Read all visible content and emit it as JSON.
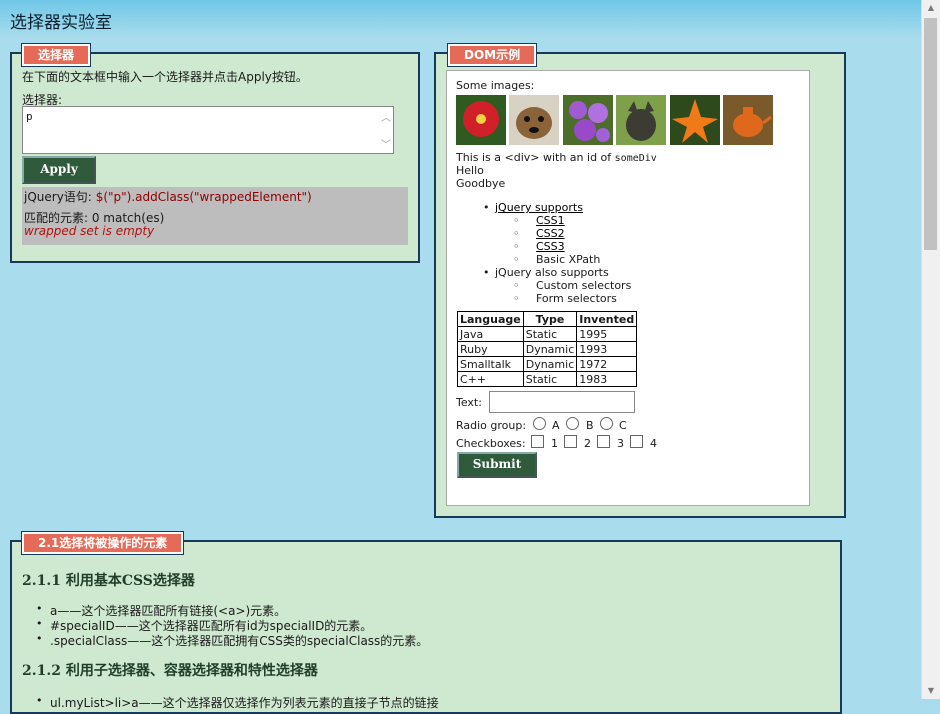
{
  "page": {
    "title": "选择器实验室"
  },
  "selector_panel": {
    "legend": "选择器",
    "instruction": "在下面的文本框中输入一个选择器并点击Apply按钮。",
    "selector_label": "选择器:",
    "selector_value": "p",
    "apply_label": "Apply",
    "statement_prefix": "jQuery语句:",
    "statement_code": "$(\"p\").addClass(\"wrappedElement\")",
    "match_text": "匹配的元素: 0 match(es)",
    "empty_text": "wrapped set is empty"
  },
  "dom_panel": {
    "legend": "DOM示例",
    "images_label": "Some images:",
    "images": [
      {
        "name": "flower-red",
        "color": "#c8232b"
      },
      {
        "name": "dog",
        "color": "#8a6a3a"
      },
      {
        "name": "flower-purple",
        "color": "#9b4fc0"
      },
      {
        "name": "cat",
        "color": "#5a5a4a"
      },
      {
        "name": "lily-orange",
        "color": "#e87a1a"
      },
      {
        "name": "teapot",
        "color": "#d2601a"
      }
    ],
    "div_text_prefix": "This is a <div> with an id of",
    "div_id": "someDiv",
    "hello": "Hello",
    "goodbye": "Goodbye",
    "list": {
      "item1": "jQuery supports",
      "sub1": [
        "CSS1",
        "CSS2",
        "CSS3",
        "Basic XPath"
      ],
      "item2": "jQuery also supports",
      "sub2": [
        "Custom selectors",
        "Form selectors"
      ]
    },
    "table": {
      "headers": [
        "Language",
        "Type",
        "Invented"
      ],
      "rows": [
        [
          "Java",
          "Static",
          "1995"
        ],
        [
          "Ruby",
          "Dynamic",
          "1993"
        ],
        [
          "Smalltalk",
          "Dynamic",
          "1972"
        ],
        [
          "C++",
          "Static",
          "1983"
        ]
      ]
    },
    "text_label": "Text:",
    "radio_label": "Radio group:",
    "radios": [
      "A",
      "B",
      "C"
    ],
    "checkbox_label": "Checkboxes:",
    "checkboxes": [
      "1",
      "2",
      "3",
      "4"
    ],
    "submit_label": "Submit"
  },
  "section": {
    "legend": "2.1选择将被操作的元素",
    "h1": "2.1.1  利用基本CSS选择器",
    "items": [
      "a——这个选择器匹配所有链接(<a>)元素。",
      "#specialID——这个选择器匹配所有id为specialID的元素。",
      ".specialClass——这个选择器匹配拥有CSS类的specialClass的元素。"
    ],
    "h2": "2.1.2  利用子选择器、容器选择器和特性选择器",
    "item_partial": "ul.myList>li>a——这个选择器仅选择作为列表元素的直接子节点的链接"
  }
}
